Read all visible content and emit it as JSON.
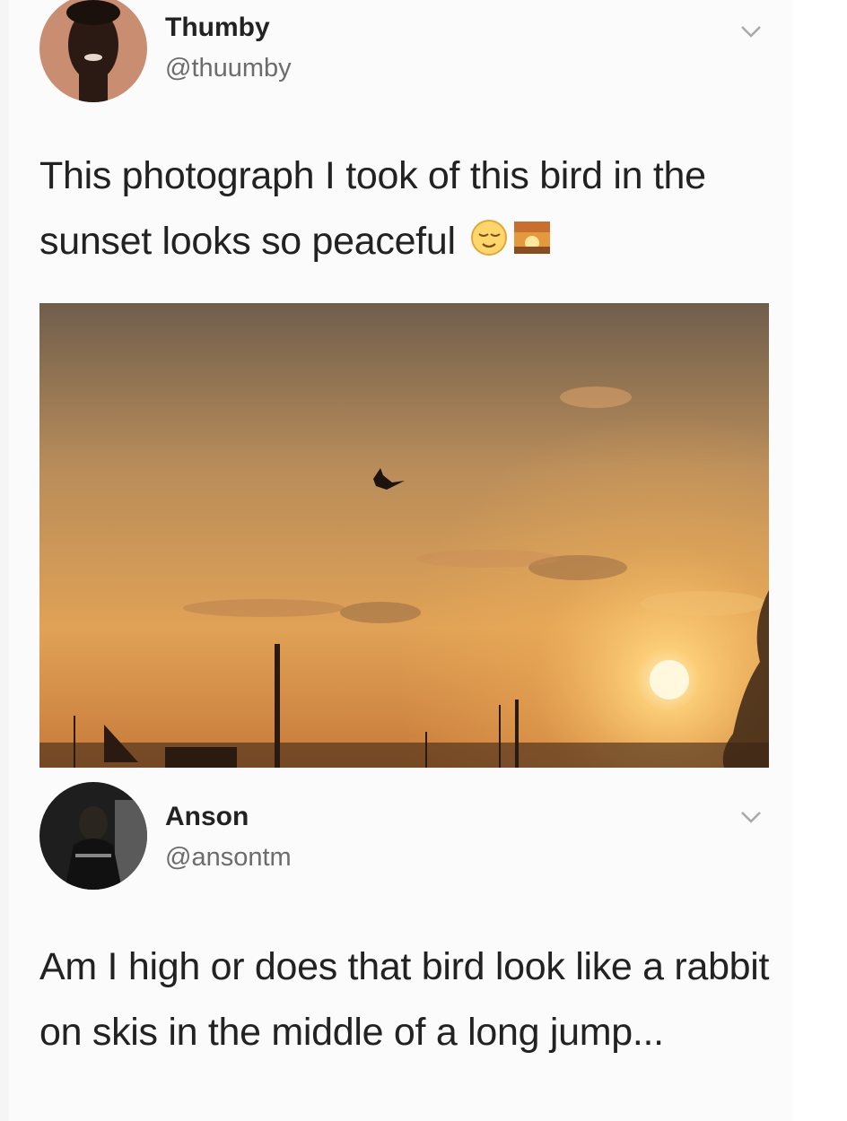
{
  "tweet1": {
    "name": "Thumby",
    "handle": "@thuumby",
    "text": "This photograph I took of this bird in the sunset looks so peaceful",
    "emojis": [
      "relieved-face",
      "sunset"
    ],
    "image_alt": "bird silhouette flying in orange sunset sky"
  },
  "tweet2": {
    "name": "Anson",
    "handle": "@ansontm",
    "text": "Am I high or does that bird look like a rabbit on skis in the middle of a long jump..."
  },
  "icons": {
    "menu": "chevron-down-icon"
  },
  "colors": {
    "handle_gray": "#6c6c6c",
    "sky_top": "#6f5e4c",
    "sky_glow": "#f2b25a",
    "sun": "#fff6d0"
  }
}
